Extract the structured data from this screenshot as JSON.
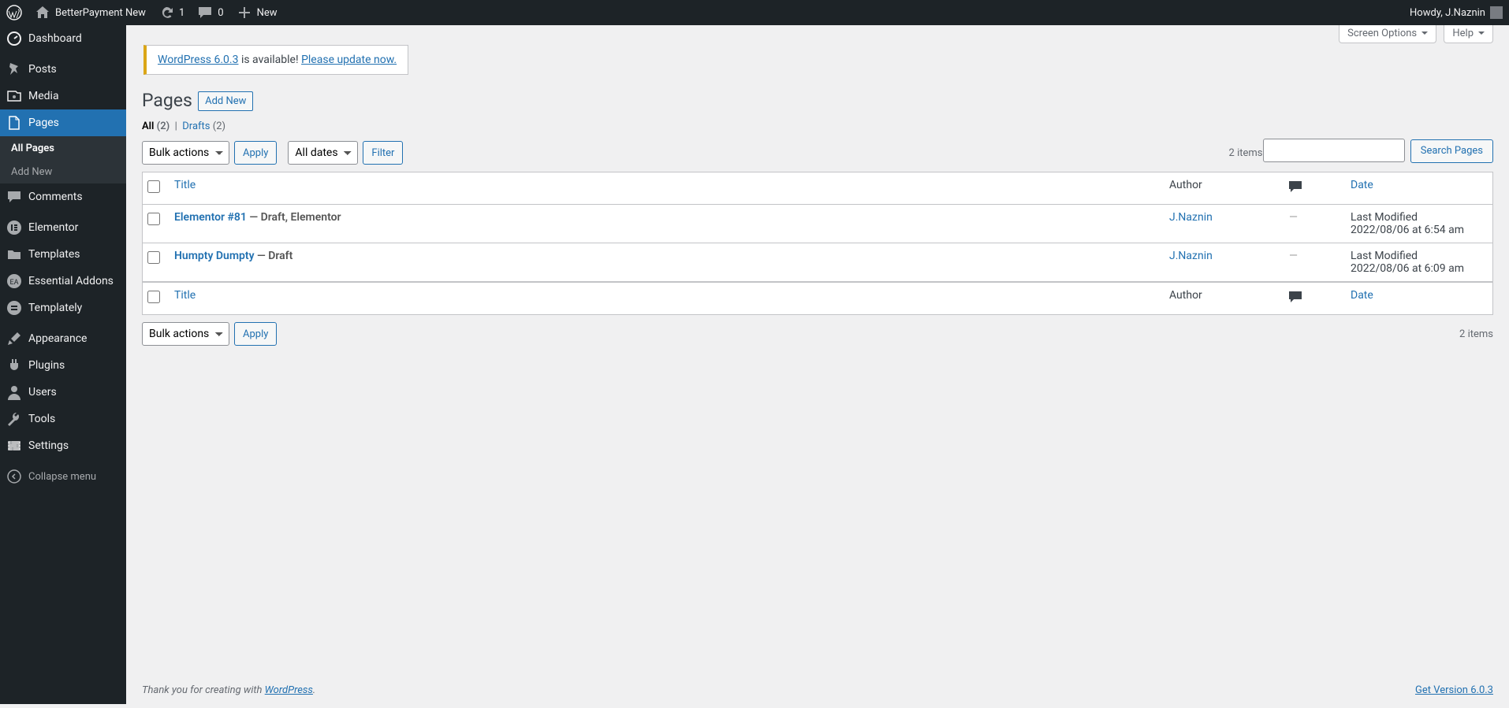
{
  "toolbar": {
    "site_name": "BetterPayment New",
    "updates": "1",
    "comments": "0",
    "new": "New",
    "howdy": "Howdy, J.Naznin"
  },
  "adminmenu": {
    "items": [
      {
        "label": "Dashboard"
      },
      {
        "label": "Posts"
      },
      {
        "label": "Media"
      },
      {
        "label": "Pages"
      },
      {
        "label": "Comments"
      },
      {
        "label": "Elementor"
      },
      {
        "label": "Templates"
      },
      {
        "label": "Essential Addons"
      },
      {
        "label": "Templately"
      },
      {
        "label": "Appearance"
      },
      {
        "label": "Plugins"
      },
      {
        "label": "Users"
      },
      {
        "label": "Tools"
      },
      {
        "label": "Settings"
      }
    ],
    "submenu": {
      "all_pages": "All Pages",
      "add_new": "Add New"
    },
    "collapse": "Collapse menu"
  },
  "screen_links": {
    "screen_options": "Screen Options",
    "help": "Help"
  },
  "nag": {
    "prefix": "WordPress 6.0.3",
    "mid": " is available! ",
    "link": "Please update now."
  },
  "heading": {
    "title": "Pages",
    "add_new": "Add New"
  },
  "filters": {
    "all": "All",
    "all_count": "(2)",
    "drafts": "Drafts",
    "drafts_count": "(2)",
    "bulk": "Bulk actions",
    "apply": "Apply",
    "dates": "All dates",
    "filter": "Filter",
    "search_btn": "Search Pages",
    "items_count": "2 items"
  },
  "table": {
    "cols": {
      "title": "Title",
      "author": "Author",
      "date": "Date"
    },
    "rows": [
      {
        "title": "Elementor #81",
        "state": " — Draft, Elementor",
        "author": "J.Naznin",
        "comments": "—",
        "date_l1": "Last Modified",
        "date_l2": "2022/08/06 at 6:54 am"
      },
      {
        "title": "Humpty Dumpty",
        "state": " — Draft",
        "author": "J.Naznin",
        "comments": "—",
        "date_l1": "Last Modified",
        "date_l2": "2022/08/06 at 6:09 am"
      }
    ]
  },
  "footer": {
    "thank": "Thank you for creating with ",
    "wp": "WordPress",
    "version": "Get Version 6.0.3"
  }
}
